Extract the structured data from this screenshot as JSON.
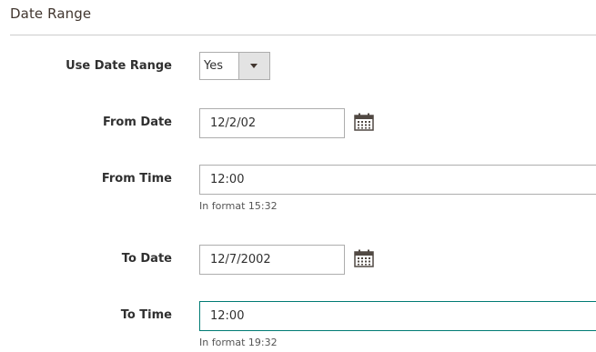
{
  "section": {
    "title": "Date Range"
  },
  "fields": {
    "use_date_range": {
      "label": "Use Date Range",
      "value": "Yes"
    },
    "from_date": {
      "label": "From Date",
      "value": "12/2/02"
    },
    "from_time": {
      "label": "From Time",
      "value": "12:00",
      "note": "In format 15:32"
    },
    "to_date": {
      "label": "To Date",
      "value": "12/7/2002"
    },
    "to_time": {
      "label": "To Time",
      "value": "12:00",
      "note": "In format 19:32"
    }
  },
  "icons": {
    "calendar": "calendar-icon",
    "dropdown": "chevron-down-icon"
  },
  "colors": {
    "focus_border": "#007b74",
    "border": "#adadad",
    "select_button_bg": "#e3e3e3"
  }
}
